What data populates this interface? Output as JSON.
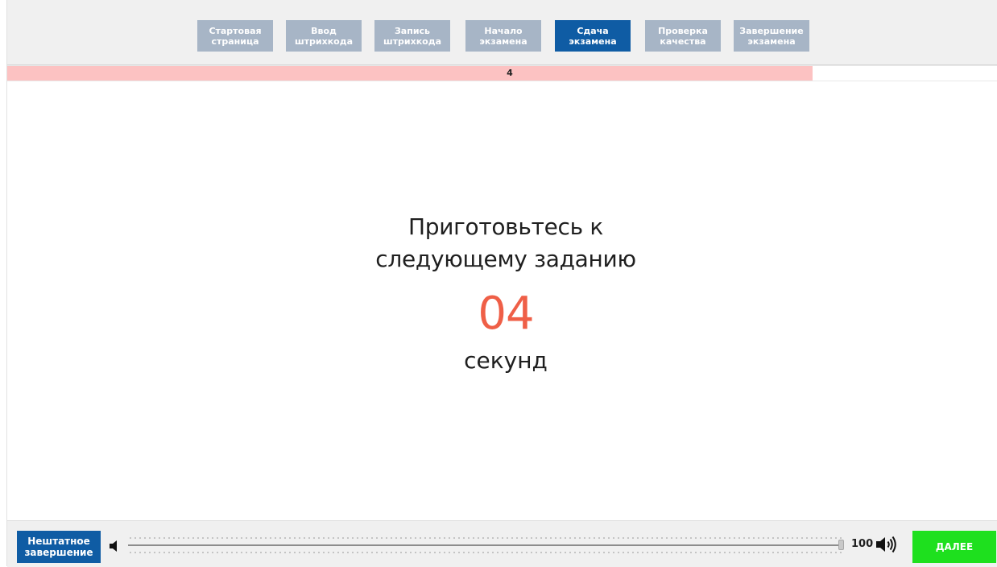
{
  "header": {
    "tabs": [
      {
        "line1": "Стартовая",
        "line2": "страница",
        "active": false
      },
      {
        "line1": "Ввод",
        "line2": "штрихкода",
        "active": false
      },
      {
        "line1": "Запись",
        "line2": "штрихкода",
        "active": false
      },
      {
        "line1": "Начало",
        "line2": "экзамена",
        "active": false
      },
      {
        "line1": "Сдача",
        "line2": "экзамена",
        "active": true
      },
      {
        "line1": "Проверка",
        "line2": "качества",
        "active": false
      },
      {
        "line1": "Завершение",
        "line2": "экзамена",
        "active": false
      }
    ]
  },
  "progress": {
    "label": "4",
    "fill_fraction": 0.813,
    "fill_color": "#fcc2c2"
  },
  "message": {
    "line1": "Приготовьтесь к",
    "line2": "следующему заданию",
    "countdown": "04",
    "unit": "секунд",
    "countdown_color": "#ef5f47"
  },
  "footer": {
    "abort_line1": "Нештатное",
    "abort_line2": "завершение",
    "volume_value": "100",
    "volume_fraction": 1.0,
    "next_label": "ДАЛЕЕ",
    "icons": {
      "volume_low": "speaker-low-icon",
      "volume_high": "speaker-high-icon"
    }
  },
  "colors": {
    "tab_inactive": "#a7b5c6",
    "tab_active": "#0f5ca4",
    "next_button": "#1ee01e"
  }
}
